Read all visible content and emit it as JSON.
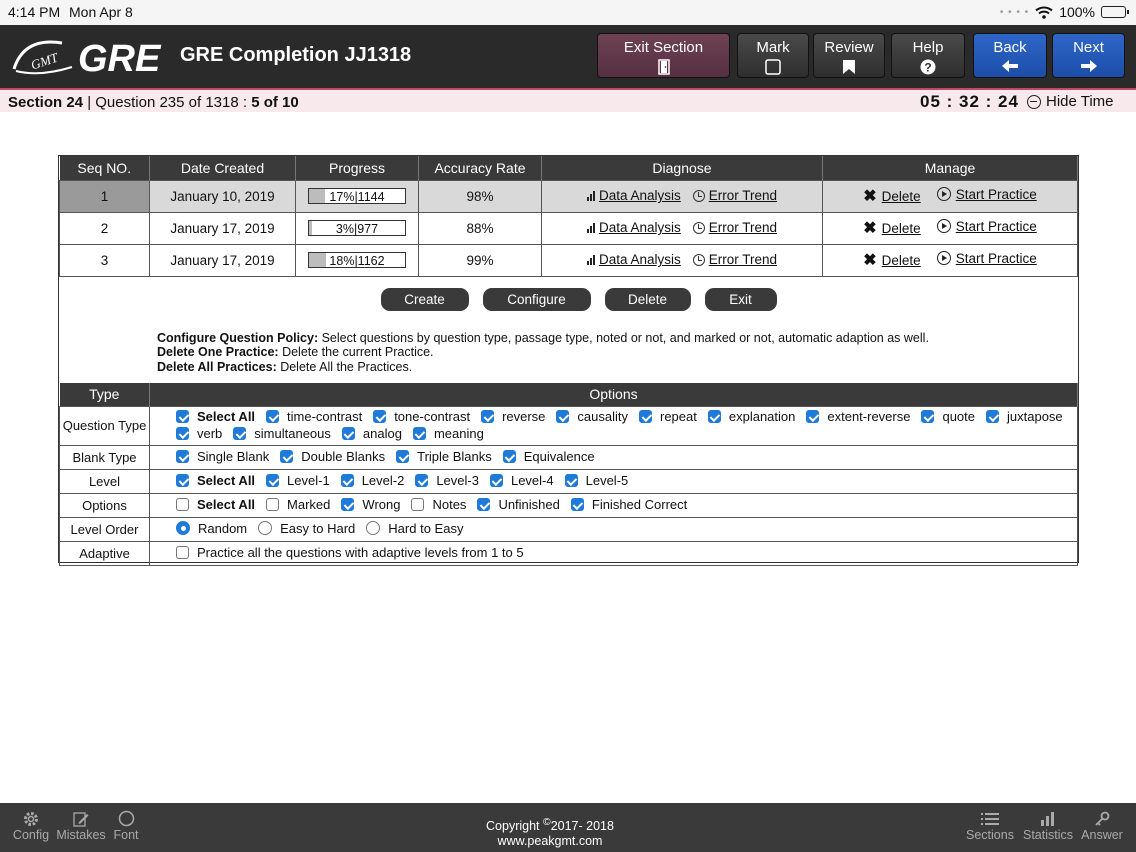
{
  "status_bar": {
    "time": "4:14 PM",
    "date": "Mon Apr 8",
    "battery": "100%"
  },
  "header": {
    "logo_text": "GRE",
    "logo_badge": "GMT",
    "title": "GRE Completion JJ1318",
    "buttons": {
      "exit_section": "Exit Section",
      "mark": "Mark",
      "review": "Review",
      "help": "Help",
      "back": "Back",
      "next": "Next"
    }
  },
  "section_bar": {
    "section": "Section 24",
    "separator": " | ",
    "question": "Question 235 of 1318 : ",
    "progress": "5 of 10",
    "timer": "05 : 32 : 24",
    "hide_time": "Hide Time"
  },
  "practice_table": {
    "headers": [
      "Seq NO.",
      "Date Created",
      "Progress",
      "Accuracy Rate",
      "Diagnose",
      "Manage"
    ],
    "rows": [
      {
        "seq": "1",
        "date": "January 10, 2019",
        "progress_text": "17%|1144",
        "progress_pct": 17,
        "accuracy": "98%",
        "data_analysis": "Data Analysis",
        "error_trend": "Error Trend",
        "delete": "Delete",
        "start": "Start Practice"
      },
      {
        "seq": "2",
        "date": "January 17, 2019",
        "progress_text": "3%|977",
        "progress_pct": 3,
        "accuracy": "88%",
        "data_analysis": "Data Analysis",
        "error_trend": "Error Trend",
        "delete": "Delete",
        "start": "Start Practice"
      },
      {
        "seq": "3",
        "date": "January 17, 2019",
        "progress_text": "18%|1162",
        "progress_pct": 18,
        "accuracy": "99%",
        "data_analysis": "Data Analysis",
        "error_trend": "Error Trend",
        "delete": "Delete",
        "start": "Start Practice"
      }
    ]
  },
  "actions": {
    "create": "Create",
    "configure": "Configure",
    "delete": "Delete",
    "exit": "Exit"
  },
  "policy": {
    "configure_label": "Configure Question Policy:",
    "configure_text": " Select questions by question type, passage type, noted or not, and marked or not, automatic adaption as well.",
    "delete_one_label": "Delete One Practice:",
    "delete_one_text": " Delete the current Practice.",
    "delete_all_label": "Delete All Practices:",
    "delete_all_text": " Delete All the Practices."
  },
  "options_table": {
    "headers": {
      "type": "Type",
      "options": "Options"
    },
    "question_type": {
      "label": "Question Type",
      "items": [
        "Select All",
        "time-contrast",
        "tone-contrast",
        "reverse",
        "causality",
        "repeat",
        "explanation",
        "extent-reverse",
        "quote",
        "juxtapose",
        "verb",
        "simultaneous",
        "analog",
        "meaning"
      ]
    },
    "blank_type": {
      "label": "Blank Type",
      "items": [
        "Single Blank",
        "Double Blanks",
        "Triple Blanks",
        "Equivalence"
      ]
    },
    "level": {
      "label": "Level",
      "items": [
        "Select All",
        "Level-1",
        "Level-2",
        "Level-3",
        "Level-4",
        "Level-5"
      ]
    },
    "options": {
      "label": "Options",
      "items": [
        "Select All",
        "Marked",
        "Wrong",
        "Notes",
        "Unfinished",
        "Finished Correct"
      ]
    },
    "level_order": {
      "label": "Level Order",
      "items": [
        "Random",
        "Easy to Hard",
        "Hard to Easy"
      ]
    },
    "adaptive": {
      "label": "Adaptive",
      "items": [
        "Practice all the questions with adaptive levels from 1 to 5"
      ]
    }
  },
  "footer": {
    "config": "Config",
    "mistakes": "Mistakes",
    "font": "Font",
    "copyright_prefix": "Copyright ",
    "copyright_symbol": "©",
    "copyright_years": "2017- 2018",
    "website": "www.peakgmt.com",
    "sections": "Sections",
    "statistics": "Statistics",
    "answer": "Answer"
  }
}
